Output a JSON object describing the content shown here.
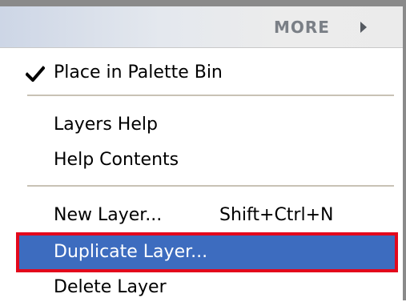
{
  "header": {
    "more_label": "MORE"
  },
  "menu": {
    "place_in_palette_bin": "Place in Palette Bin",
    "layers_help": "Layers Help",
    "help_contents": "Help Contents",
    "new_layer": "New Layer...",
    "new_layer_shortcut": "Shift+Ctrl+N",
    "duplicate_layer": "Duplicate Layer...",
    "delete_layer": "Delete Layer"
  },
  "colors": {
    "selection": "#3d6cbf",
    "highlight_outline": "#e3081c"
  }
}
